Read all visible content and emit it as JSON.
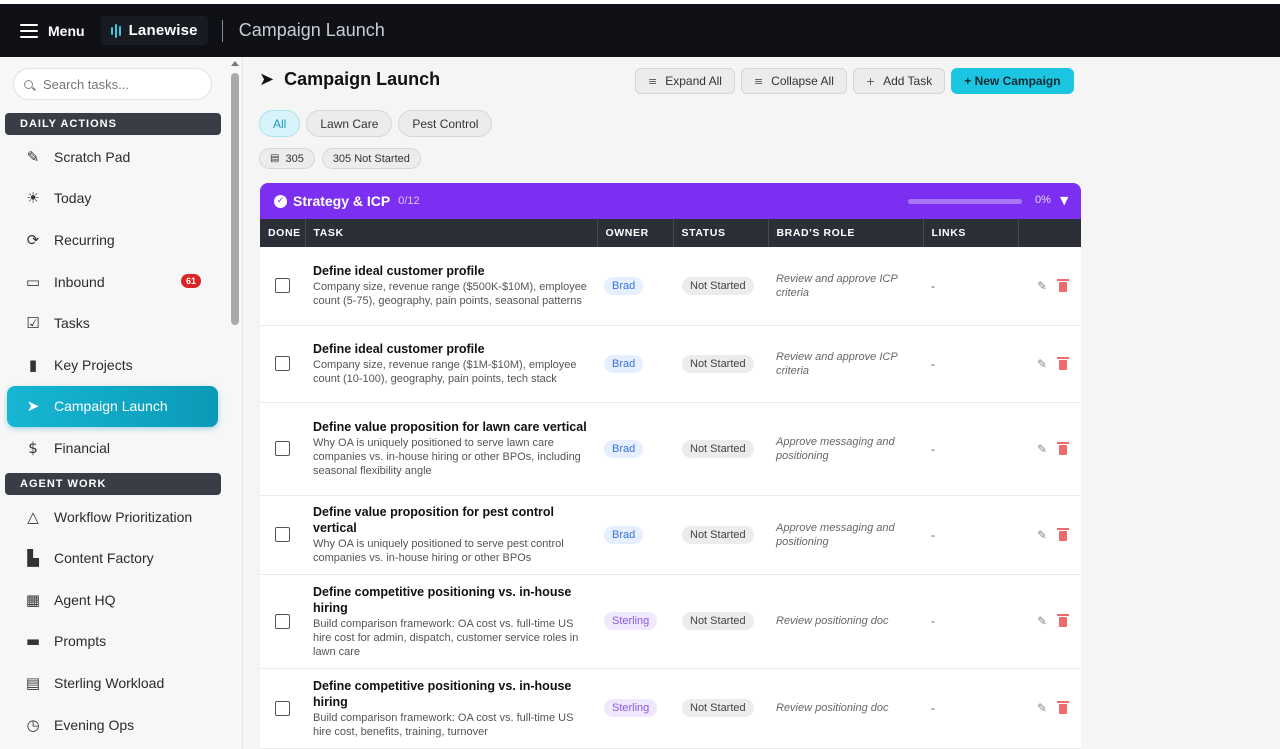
{
  "topbar": {
    "menu_label": "Menu",
    "brand": "Lanewise",
    "page_title": "Campaign Launch"
  },
  "sidebar": {
    "search_placeholder": "Search tasks...",
    "sections": [
      {
        "label": "DAILY ACTIONS",
        "items": [
          {
            "label": "Scratch Pad",
            "icon": "pencil-icon"
          },
          {
            "label": "Today",
            "icon": "sun-icon"
          },
          {
            "label": "Recurring",
            "icon": "refresh-icon"
          },
          {
            "label": "Inbound",
            "icon": "inbox-icon",
            "badge": "61"
          },
          {
            "label": "Tasks",
            "icon": "checkbox-icon"
          },
          {
            "label": "Key Projects",
            "icon": "bookmark-icon"
          },
          {
            "label": "Campaign Launch",
            "icon": "send-icon",
            "active": true
          },
          {
            "label": "Financial",
            "icon": "dollar-icon"
          }
        ]
      },
      {
        "label": "AGENT WORK",
        "items": [
          {
            "label": "Workflow Prioritization",
            "icon": "shapes-icon"
          },
          {
            "label": "Content Factory",
            "icon": "factory-icon"
          },
          {
            "label": "Agent HQ",
            "icon": "building-icon"
          },
          {
            "label": "Prompts",
            "icon": "chat-icon"
          },
          {
            "label": "Sterling Workload",
            "icon": "document-icon"
          },
          {
            "label": "Evening Ops",
            "icon": "clock-icon"
          }
        ]
      }
    ]
  },
  "main": {
    "title": "Campaign Launch",
    "actions": {
      "expand_all": "Expand All",
      "collapse_all": "Collapse All",
      "add_task": "Add Task",
      "new_campaign": "+ New Campaign"
    },
    "filters": [
      "All",
      "Lawn Care",
      "Pest Control"
    ],
    "active_filter": "All",
    "counts": {
      "total": "305",
      "not_started": "305 Not Started"
    },
    "group": {
      "name": "Strategy & ICP",
      "count": "0/12",
      "percent": "0%",
      "progress_fraction": 0,
      "color": "#7c2ff0"
    },
    "columns": [
      "DONE",
      "TASK",
      "OWNER",
      "STATUS",
      "BRAD'S ROLE",
      "LINKS",
      ""
    ],
    "tasks": [
      {
        "title": "Define ideal customer profile",
        "desc": "Company size, revenue range ($500K-$10M), employee count (5-75), geography, pain points, seasonal patterns",
        "owner": "Brad",
        "status": "Not Started",
        "role": "Review and approve ICP criteria",
        "links": "-"
      },
      {
        "title": "Define ideal customer profile",
        "desc": "Company size, revenue range ($1M-$10M), employee count (10-100), geography, pain points, tech stack",
        "owner": "Brad",
        "status": "Not Started",
        "role": "Review and approve ICP criteria",
        "links": "-"
      },
      {
        "title": "Define value proposition for lawn care vertical",
        "desc": "Why OA is uniquely positioned to serve lawn care companies vs. in-house hiring or other BPOs, including seasonal flexibility angle",
        "owner": "Brad",
        "status": "Not Started",
        "role": "Approve messaging and positioning",
        "links": "-"
      },
      {
        "title": "Define value proposition for pest control vertical",
        "desc": "Why OA is uniquely positioned to serve pest control companies vs. in-house hiring or other BPOs",
        "owner": "Brad",
        "status": "Not Started",
        "role": "Approve messaging and positioning",
        "links": "-"
      },
      {
        "title": "Define competitive positioning vs. in-house hiring",
        "desc": "Build comparison framework: OA cost vs. full-time US hire cost for admin, dispatch, customer service roles in lawn care",
        "owner": "Sterling",
        "status": "Not Started",
        "role": "Review positioning doc",
        "links": "-"
      },
      {
        "title": "Define competitive positioning vs. in-house hiring",
        "desc": "Build comparison framework: OA cost vs. full-time US hire cost, benefits, training, turnover",
        "owner": "Sterling",
        "status": "Not Started",
        "role": "Review positioning doc",
        "links": "-"
      }
    ]
  }
}
